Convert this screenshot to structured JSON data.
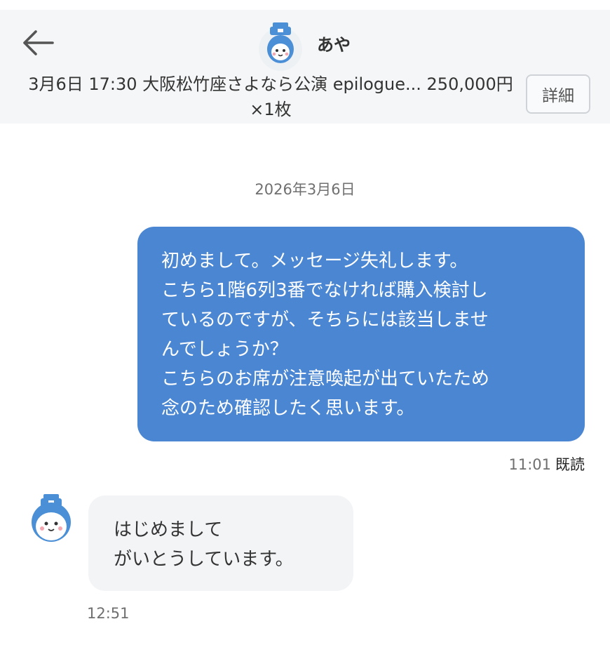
{
  "header": {
    "contact_name": "あや",
    "ticket_info": "3月6日 17:30 大阪松竹座さよなら公演 epilogue... 250,000円×1枚",
    "detail_label": "詳細",
    "avatar_icon": "mascot-avatar-icon",
    "back_icon": "arrow-left-icon"
  },
  "chat": {
    "date_divider": "2026年3月6日",
    "messages": [
      {
        "direction": "sent",
        "text": "初めまして。メッセージ失礼します。\nこちら1階6列3番でなければ購入検討し\nているのですが、そちらには該当しませ\nんでしょうか？\nこちらのお席が注意喚起が出ていたため\n念のため確認したく思います。",
        "time": "11:01",
        "status": "既読"
      },
      {
        "direction": "received",
        "text": "はじめまして\nがいとうしています。",
        "time": "12:51"
      }
    ]
  },
  "colors": {
    "sent_bubble": "#4a86d2",
    "received_bubble": "#f3f4f6",
    "header_bg": "#f5f6f7",
    "mascot_blue": "#4b8fd6"
  }
}
